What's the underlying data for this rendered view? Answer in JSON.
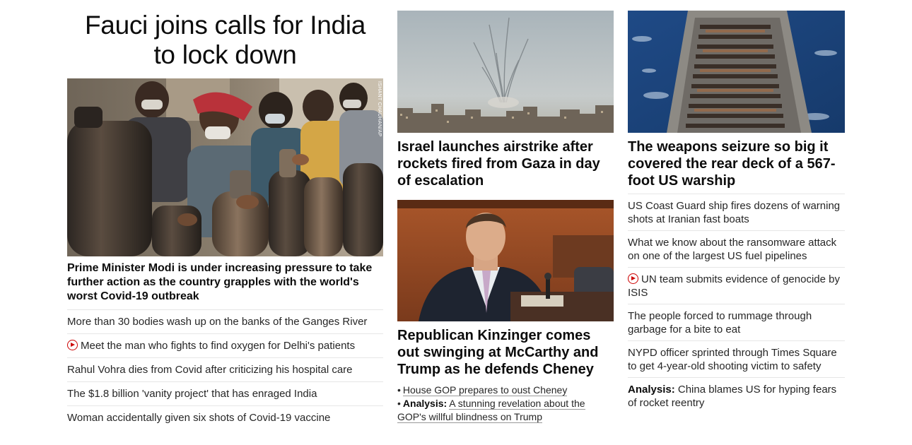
{
  "column1": {
    "headline_line1": "Fauci joins calls for India",
    "headline_line2": "to lock down",
    "photo_credit": "ISHANT CHAUHAN/AP",
    "lead": "Prime Minister Modi is under increasing pressure to take further action as the country grapples with the world's worst Covid-19 outbreak",
    "items": [
      {
        "text": "More than 30 bodies wash up on the banks of the Ganges River",
        "video": false
      },
      {
        "text": "Meet the man who fights to find oxygen for Delhi's patients",
        "video": true
      },
      {
        "text": "Rahul Vohra dies from Covid after criticizing his hospital care",
        "video": false
      },
      {
        "text": "The $1.8 billion 'vanity project' that has enraged India",
        "video": false
      },
      {
        "text": "Woman accidentally given six shots of Covid-19 vaccine",
        "video": false
      }
    ]
  },
  "column2": {
    "story1": {
      "headline": "Israel launches airstrike after rockets fired from Gaza in day of escalation"
    },
    "story2": {
      "headline": "Republican Kinzinger comes out swinging at McCarthy and Trump as he defends Cheney",
      "sub_links": [
        {
          "bullet": "•",
          "prefix": "",
          "text": "House GOP prepares to oust Cheney"
        },
        {
          "bullet": "•",
          "prefix": "Analysis:",
          "text": "A stunning revelation about the GOP's willful blindness on Trump"
        }
      ]
    }
  },
  "column3": {
    "headline": "The weapons seizure so big it covered the rear deck of a 567-foot US warship",
    "items": [
      {
        "text": "US Coast Guard ship fires dozens of warning shots at Iranian fast boats",
        "video": false,
        "prefix": ""
      },
      {
        "text": "What we know about the ransomware attack on one of the largest US fuel pipelines",
        "video": false,
        "prefix": ""
      },
      {
        "text": "UN team submits evidence of genocide by ISIS",
        "video": true,
        "prefix": ""
      },
      {
        "text": "The people forced to rummage through garbage for a bite to eat",
        "video": false,
        "prefix": ""
      },
      {
        "text": "NYPD officer sprinted through Times Square to get 4-year-old shooting victim to safety",
        "video": false,
        "prefix": ""
      },
      {
        "text": "China blames US for hyping fears of rocket reentry",
        "video": false,
        "prefix": "Analysis:"
      }
    ]
  },
  "colors": {
    "accent_red": "#cc0000",
    "text": "#0c0c0c",
    "divider": "#e6e6e6"
  }
}
